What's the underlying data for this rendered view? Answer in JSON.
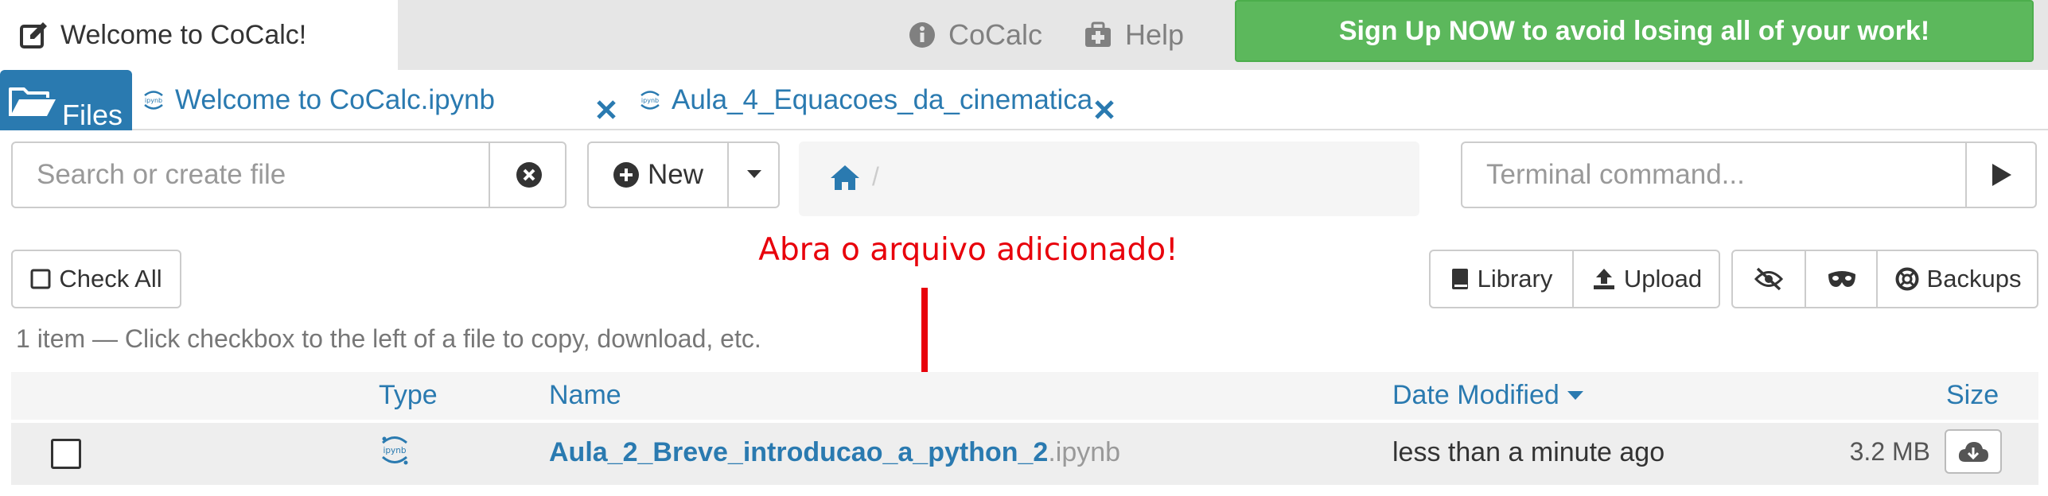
{
  "topbar": {
    "welcome_tab": "Welcome to CoCalc!",
    "cocalc_link": "CoCalc",
    "help_link": "Help",
    "signup_button": "Sign Up NOW to avoid losing all of your work!"
  },
  "tabs": {
    "files_label": "Files",
    "open_files": [
      {
        "label": "Welcome to CoCalc.ipynb",
        "icon": "ipynb-icon"
      },
      {
        "label": "Aula_4_Equacoes_da_cinematica",
        "icon": "ipynb-icon"
      }
    ]
  },
  "controls": {
    "search_placeholder": "Search or create file",
    "new_label": "New",
    "breadcrumb_separator": "/",
    "terminal_placeholder": "Terminal command..."
  },
  "actions": {
    "check_all": "Check All",
    "library": "Library",
    "upload": "Upload",
    "backups": "Backups"
  },
  "annotation": "Abra o arquivo adicionado!",
  "info_line": "1 item — Click checkbox to the left of a file to copy, download, etc.",
  "table": {
    "headers": {
      "type": "Type",
      "name": "Name",
      "date": "Date Modified",
      "size": "Size"
    },
    "rows": [
      {
        "type_icon": "ipynb-icon",
        "name": "Aula_2_Breve_introducao_a_python_2",
        "ext": ".ipynb",
        "date": "less than a minute ago",
        "size": "3.2 MB"
      }
    ]
  },
  "colors": {
    "accent": "#2a7ab0",
    "signup_green": "#5cb85c",
    "annotation_red": "#e8000b",
    "topbar_bg": "#e6e6e6"
  }
}
